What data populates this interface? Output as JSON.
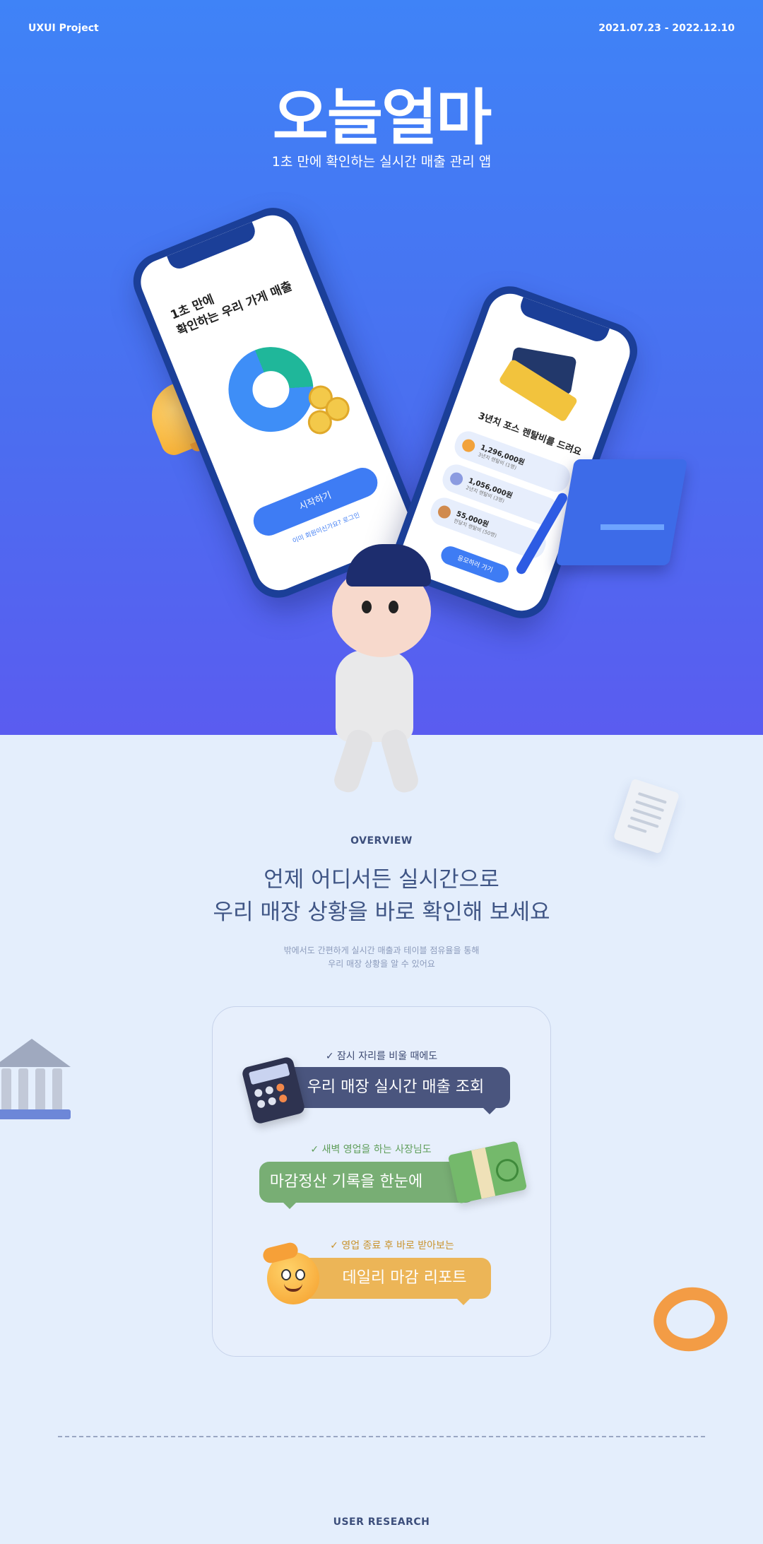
{
  "header": {
    "project": "UXUI Project",
    "period": "2021.07.23 - 2022.12.10"
  },
  "hero": {
    "brand": "오늘얼마",
    "tagline": "1초 만에 확인하는 실시간 매출 관리 앱"
  },
  "phone_left": {
    "headline": "1초 만에\n확인하는 우리 가게 매출",
    "start_button": "시작하기",
    "login_link": "이미 회원이신가요? 로그인"
  },
  "phone_right": {
    "headline": "3년치 포스 렌탈비를 드려요",
    "prizes": [
      {
        "amount": "1,296,000원",
        "desc": "3년치 렌탈비 (1명)",
        "medal_color": "#f2a23b"
      },
      {
        "amount": "1,056,000원",
        "desc": "2년치 렌탈비 (3명)",
        "medal_color": "#8b9be0"
      },
      {
        "amount": "55,000원",
        "desc": "한달치 렌탈비 (50명)",
        "medal_color": "#d08a4e"
      }
    ],
    "apply_button": "응모하러 가기"
  },
  "overview": {
    "label": "OVERVIEW",
    "title_line1": "언제 어디서든 실시간으로",
    "title_line2": "우리 매장 상황을 바로 확인해 보세요",
    "desc_line1": "밖에서도 간편하게 실시간 매출과 테이블 점유율을 통해",
    "desc_line2": "우리 매장 상황을 알 수 있어요"
  },
  "features": [
    {
      "check": "✓ 잠시 자리를 비울 때에도",
      "label": "우리 매장 실시간 매출 조회",
      "color": "#4a557e",
      "check_color": "#3d4a72"
    },
    {
      "check": "✓ 새벽 영업을 하는 사장님도",
      "label": "마감정산 기록을 한눈에",
      "color": "#78ae74",
      "check_color": "#5f9e5a"
    },
    {
      "check": "✓ 영업 종료 후 바로 받아보는",
      "label": "데일리 마감 리포트",
      "color": "#ecb557",
      "check_color": "#c9932d"
    }
  ],
  "research": {
    "label": "USER RESEARCH"
  },
  "colors": {
    "hero_top": "#3f83f7",
    "hero_bottom": "#5a5cf0",
    "accent": "#3e7cf4"
  }
}
